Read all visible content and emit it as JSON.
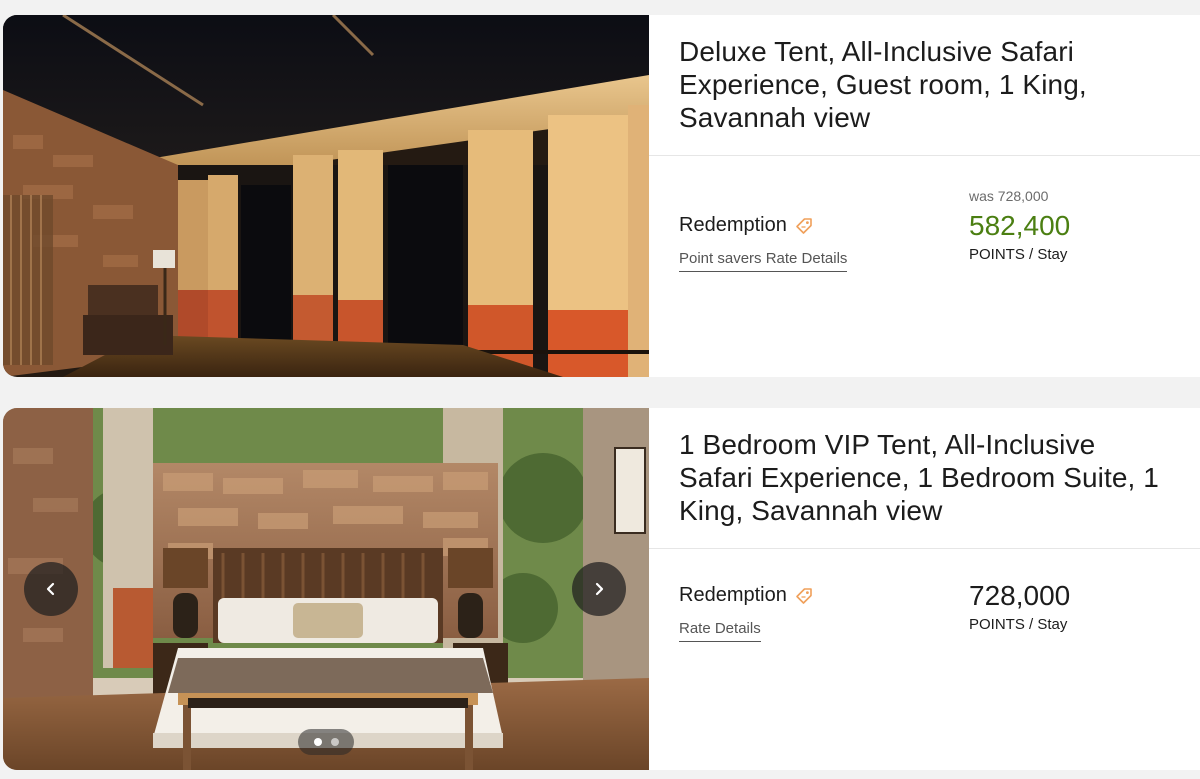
{
  "rooms": [
    {
      "title": "Deluxe Tent, All-Inclusive Safari Experience, Guest room, 1 King, Savannah view",
      "rate_name": "Redemption",
      "rate_icon": "tag-icon",
      "rate_link": "Point savers Rate Details",
      "was_price": "was 728,000",
      "price": "582,400",
      "price_color": "#4b7f12",
      "unit_points": "POINTS",
      "unit_sep": "/",
      "unit_stay": "Stay",
      "image": "tent-interior-night-curtains"
    },
    {
      "title": "1 Bedroom VIP Tent, All-Inclusive Safari Experience, 1 Bedroom Suite, 1 King, Savannah view",
      "rate_name": "Redemption",
      "rate_icon": "tag-icon",
      "rate_link": "Rate Details",
      "price": "728,000",
      "price_color": "#1c1c1c",
      "unit_points": "POINTS",
      "unit_sep": "/",
      "unit_stay": "Stay",
      "image": "tent-bedroom-king-bed",
      "carousel": {
        "prev_icon": "chevron-left-icon",
        "next_icon": "chevron-right-icon",
        "slides": 2,
        "active_slide": 1
      }
    }
  ],
  "colors": {
    "accent_orange": "#f0a05a",
    "green_price": "#4b7f12"
  }
}
